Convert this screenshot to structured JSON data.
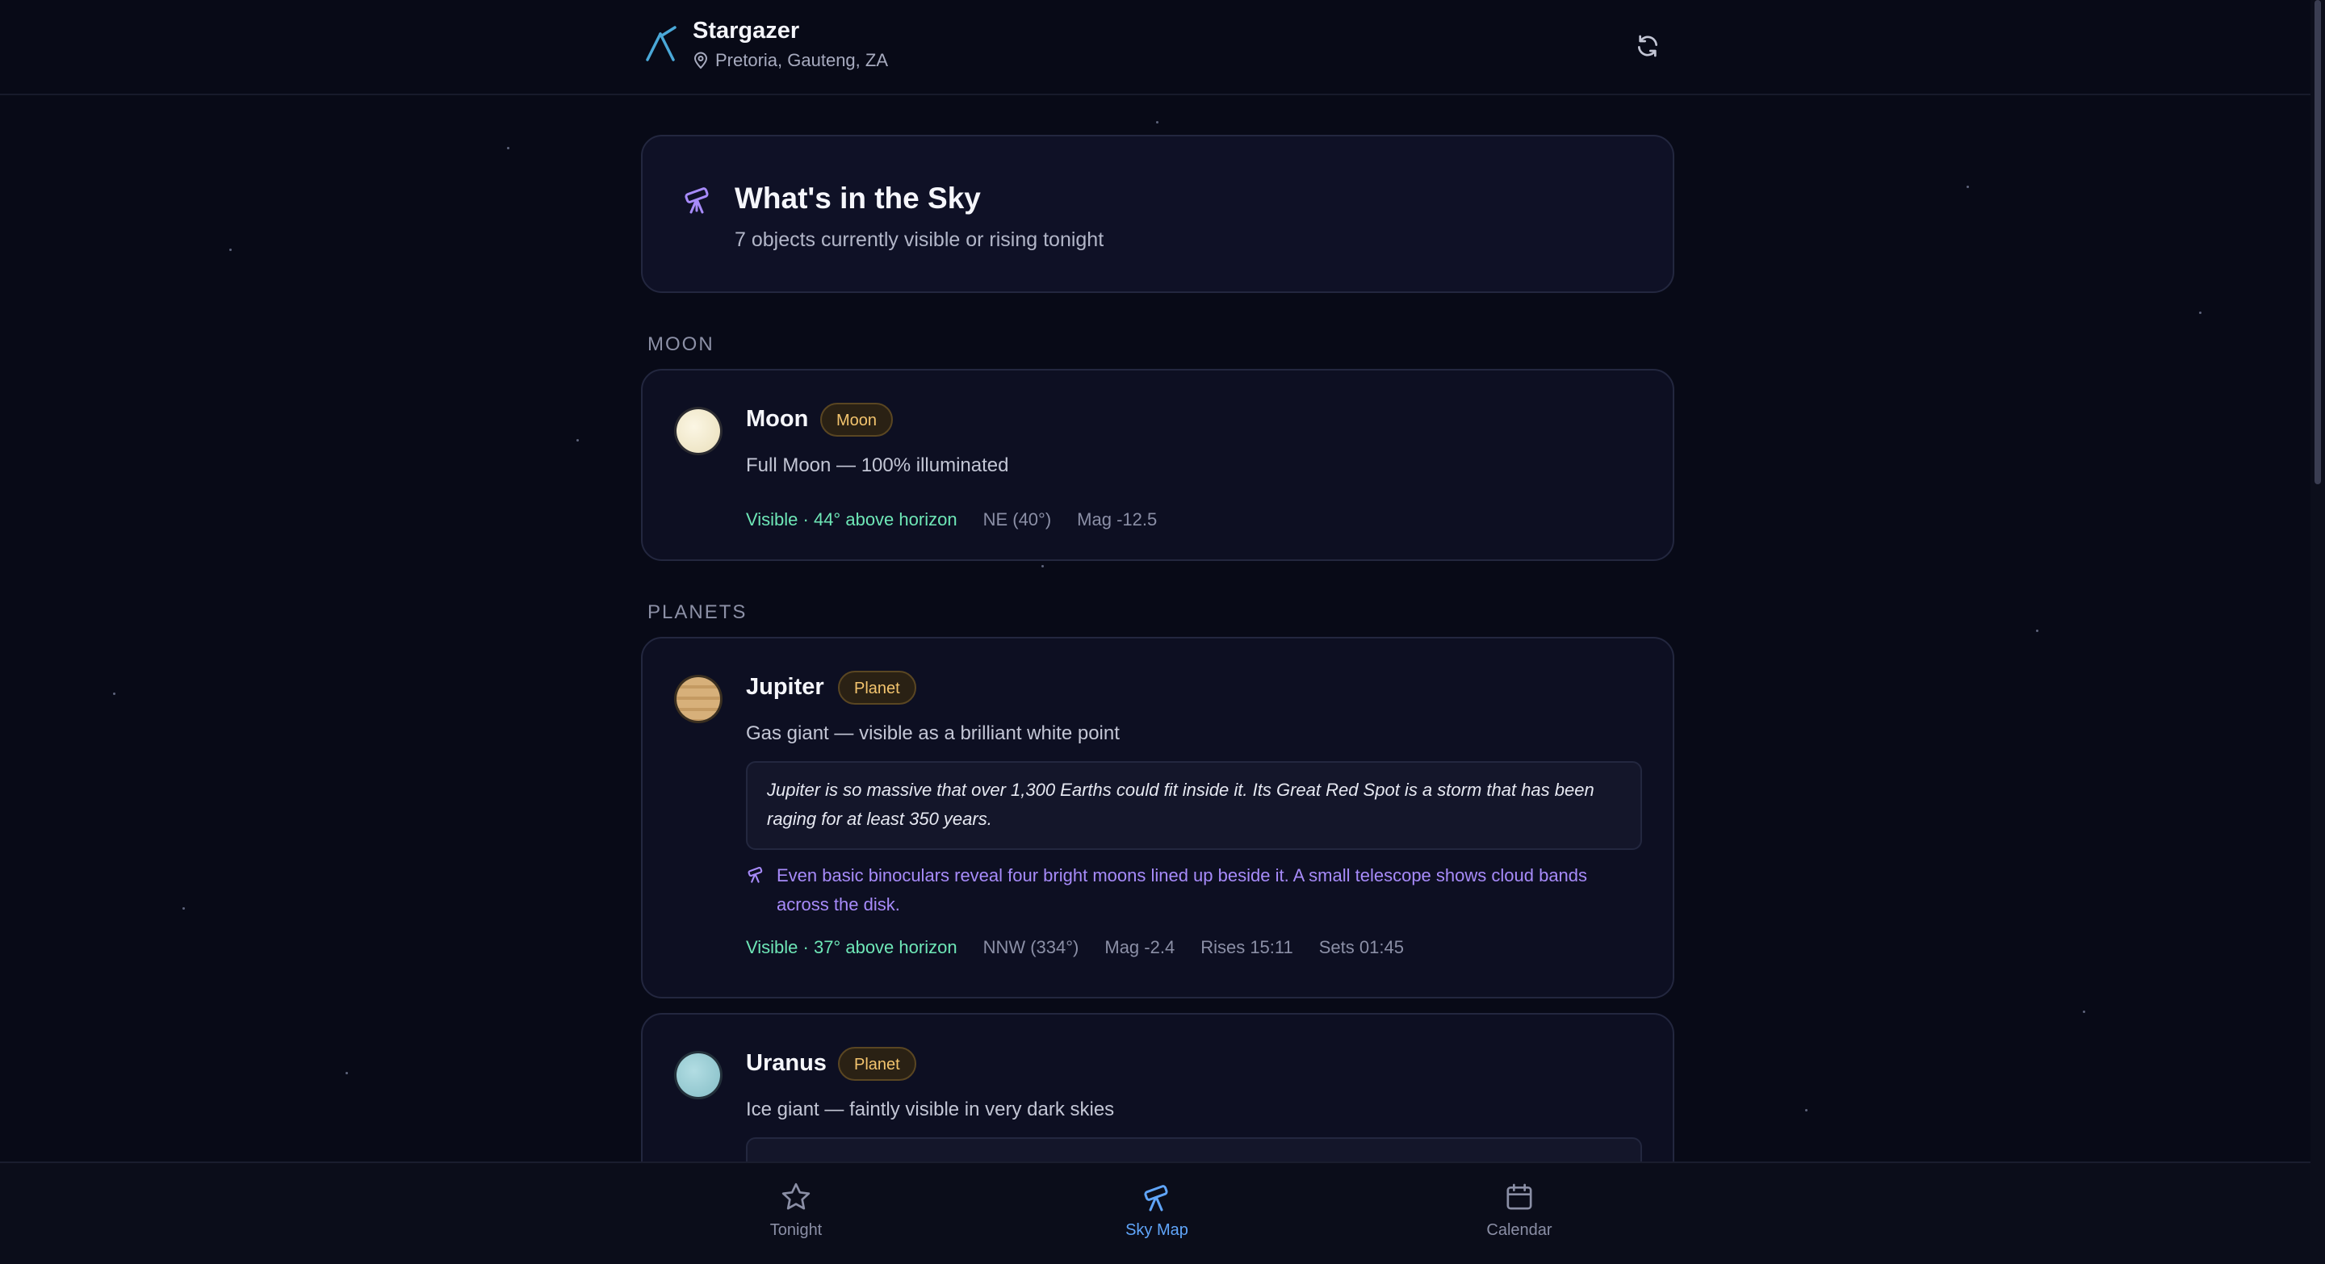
{
  "app": {
    "title": "Stargazer",
    "location": "Pretoria, Gauteng, ZA"
  },
  "hero": {
    "title": "What's in the Sky",
    "subtitle": "7 objects currently visible or rising tonight"
  },
  "sections": {
    "moon_label": "MOON",
    "planets_label": "PLANETS"
  },
  "moon": {
    "name": "Moon",
    "badge": "Moon",
    "description": "Full Moon — 100% illuminated",
    "visibility": "Visible · 44° above horizon",
    "direction": "NE (40°)",
    "magnitude": "Mag -12.5"
  },
  "jupiter": {
    "name": "Jupiter",
    "badge": "Planet",
    "description": "Gas giant — visible as a brilliant white point",
    "fact": "Jupiter is so massive that over 1,300 Earths could fit inside it. Its Great Red Spot is a storm that has been raging for at least 350 years.",
    "tip": "Even basic binoculars reveal four bright moons lined up beside it. A small telescope shows cloud bands across the disk.",
    "visibility": "Visible · 37° above horizon",
    "direction": "NNW (334°)",
    "magnitude": "Mag -2.4",
    "rises": "Rises 15:11",
    "sets": "Sets 01:45"
  },
  "uranus": {
    "name": "Uranus",
    "badge": "Planet",
    "description": "Ice giant — faintly visible in very dark skies"
  },
  "nav": {
    "tonight": "Tonight",
    "sky_map": "Sky Map",
    "calendar": "Calendar",
    "active": "sky_map"
  },
  "colors": {
    "background": "#080a17",
    "card": "#0d0f22",
    "accent_purple": "#a78bfa",
    "visible_green": "#6ee7b7",
    "badge_orange": "#f3c46e",
    "nav_active": "#60a5fa"
  },
  "icons": {
    "brand": "telescope-icon",
    "location": "map-pin-icon",
    "refresh": "refresh-icon",
    "hero": "telescope-icon",
    "tip": "telescope-icon",
    "nav_tonight": "star-icon",
    "nav_sky_map": "telescope-icon",
    "nav_calendar": "calendar-icon"
  }
}
